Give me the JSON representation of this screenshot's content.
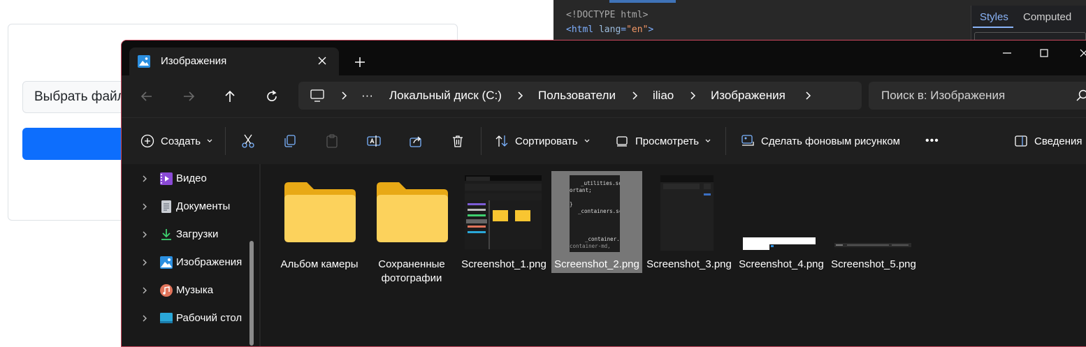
{
  "background_page": {
    "file_button_label": "Выбрать файл"
  },
  "devtools": {
    "code_line_1": "<!DOCTYPE html>",
    "code_line_2_tag_open": "<html ",
    "code_line_2_attr": "lang",
    "code_line_2_eq": "=",
    "code_line_2_value": "\"en\"",
    "code_line_2_tag_close": ">",
    "tabs": [
      "Styles",
      "Computed"
    ],
    "active_tab": "Styles"
  },
  "explorer": {
    "tab_title": "Изображения",
    "breadcrumb": {
      "overflow": "···",
      "items": [
        "Локальный диск (C:)",
        "Пользователи",
        "iliao",
        "Изображения"
      ]
    },
    "search_placeholder": "Поиск в: Изображения",
    "toolbar": {
      "create": "Создать",
      "sort": "Сортировать",
      "view": "Просмотреть",
      "set_wallpaper": "Сделать фоновым рисунком",
      "more": "•••",
      "details": "Сведения"
    },
    "nav_items": [
      {
        "label": "Видео",
        "icon": "video-folder-icon"
      },
      {
        "label": "Документы",
        "icon": "documents-folder-icon"
      },
      {
        "label": "Загрузки",
        "icon": "downloads-folder-icon"
      },
      {
        "label": "Изображения",
        "icon": "pictures-folder-icon"
      },
      {
        "label": "Музыка",
        "icon": "music-folder-icon"
      },
      {
        "label": "Рабочий стол",
        "icon": "desktop-folder-icon"
      }
    ],
    "files": [
      {
        "name": "Альбом камеры",
        "type": "folder",
        "selected": false
      },
      {
        "name": "Сохраненные фотографии",
        "type": "folder",
        "selected": false
      },
      {
        "name": "Screenshot_1.png",
        "type": "image",
        "selected": false
      },
      {
        "name": "Screenshot_2.png",
        "type": "image",
        "selected": true
      },
      {
        "name": "Screenshot_3.png",
        "type": "image",
        "selected": false
      },
      {
        "name": "Screenshot_4.png",
        "type": "image",
        "selected": false
      },
      {
        "name": "Screenshot_5.png",
        "type": "image",
        "selected": false
      }
    ],
    "thumbnail_text": {
      "shot2_line1": "_utilities.sc",
      "shot2_line2": "ortant;",
      "shot2_line3": "_containers.sc",
      "shot2_line4": "_container.s",
      "shot2_line5": "container-md,"
    }
  },
  "colors": {
    "explorer_bg": "#191919",
    "toolbar_bg": "#1f1f1f",
    "folder_yellow": "#f8c531",
    "accent_blue": "#0d6efd",
    "window_border": "#c9485e"
  }
}
